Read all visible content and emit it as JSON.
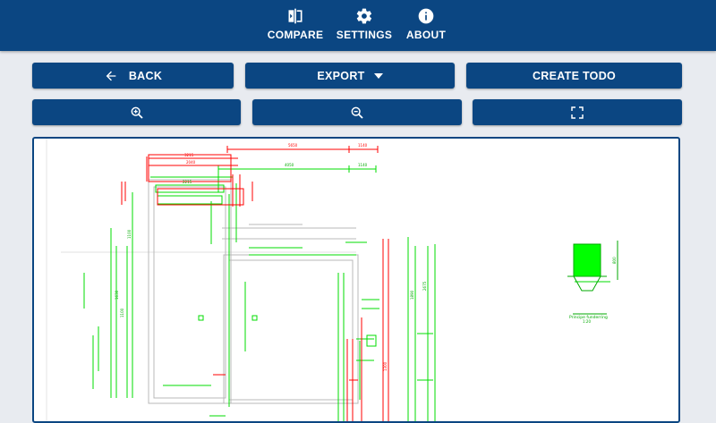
{
  "nav": {
    "items": [
      {
        "label": "COMPARE",
        "icon": "compare-icon"
      },
      {
        "label": "SETTINGS",
        "icon": "gear-icon"
      },
      {
        "label": "ABOUT",
        "icon": "info-icon"
      }
    ]
  },
  "toolbar": {
    "back_label": "BACK",
    "export_label": "EXPORT",
    "create_todo_label": "CREATE TODO",
    "back_icon": "arrow-left-icon",
    "export_icon": "caret-down-icon",
    "zoom_in_icon": "zoom-in-icon",
    "zoom_out_icon": "zoom-out-icon",
    "fit_icon": "fullscreen-icon"
  },
  "drawing": {
    "dims_top": [
      "5650",
      "1140",
      "4050",
      "1140",
      "3215",
      "2040",
      "2215"
    ],
    "dims_side": [
      "1100",
      "1100",
      "1630",
      "1890",
      "2675",
      "1300"
    ],
    "detail_title": "Principe funderring",
    "detail_scale": "1:20",
    "detail_dim": "800"
  },
  "colors": {
    "primary": "#0b4682",
    "background": "#e8ebf0",
    "cad_red": "#ff0000",
    "cad_green": "#00dd00"
  }
}
